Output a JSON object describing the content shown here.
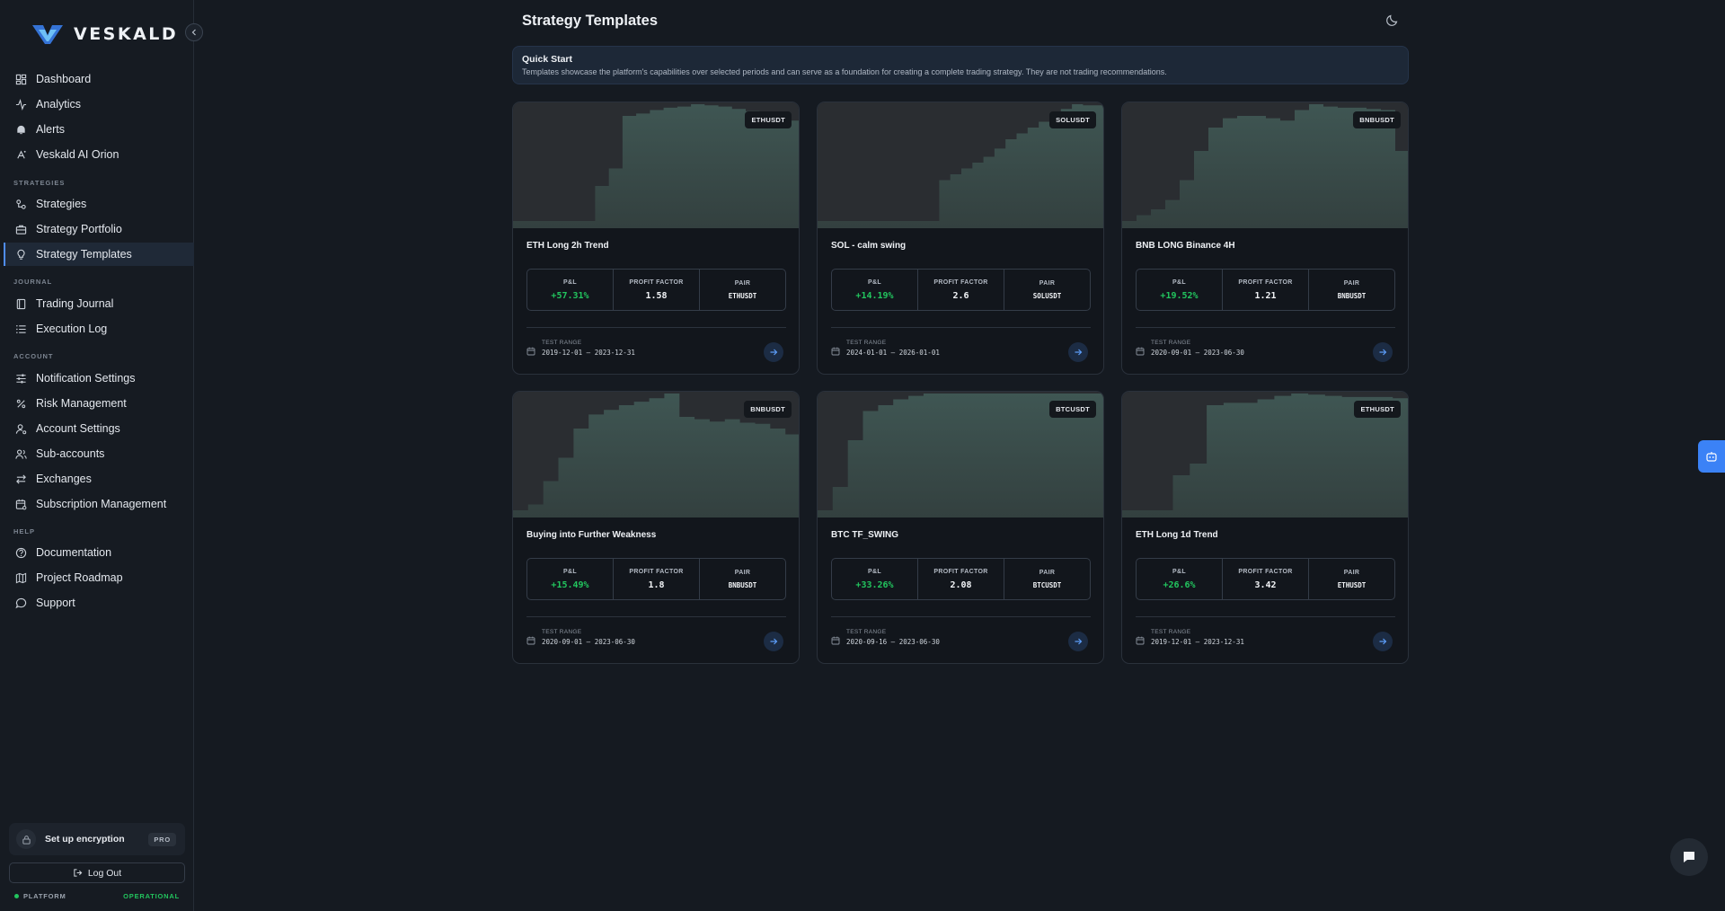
{
  "app": {
    "name": "VESKALD"
  },
  "sidebar": {
    "main_items": [
      {
        "label": "Dashboard",
        "icon": "dashboard-icon"
      },
      {
        "label": "Analytics",
        "icon": "analytics-icon"
      },
      {
        "label": "Alerts",
        "icon": "bell-icon"
      },
      {
        "label": "Veskald AI Orion",
        "icon": "ai-icon"
      }
    ],
    "sections": [
      {
        "title": "STRATEGIES",
        "items": [
          {
            "label": "Strategies",
            "icon": "strategies-icon"
          },
          {
            "label": "Strategy Portfolio",
            "icon": "briefcase-icon"
          },
          {
            "label": "Strategy Templates",
            "icon": "lightbulb-icon",
            "active": true
          }
        ]
      },
      {
        "title": "JOURNAL",
        "items": [
          {
            "label": "Trading Journal",
            "icon": "book-icon"
          },
          {
            "label": "Execution Log",
            "icon": "list-icon"
          }
        ]
      },
      {
        "title": "ACCOUNT",
        "items": [
          {
            "label": "Notification Settings",
            "icon": "sliders-icon"
          },
          {
            "label": "Risk Management",
            "icon": "percent-icon"
          },
          {
            "label": "Account Settings",
            "icon": "user-gear-icon"
          },
          {
            "label": "Sub-accounts",
            "icon": "users-icon"
          },
          {
            "label": "Exchanges",
            "icon": "swap-icon"
          },
          {
            "label": "Subscription Management",
            "icon": "calendar-settings-icon"
          }
        ]
      },
      {
        "title": "HELP",
        "items": [
          {
            "label": "Documentation",
            "icon": "help-circle-icon"
          },
          {
            "label": "Project Roadmap",
            "icon": "map-icon"
          },
          {
            "label": "Support",
            "icon": "chat-bubble-icon"
          }
        ]
      }
    ],
    "encryption": {
      "label": "Set up encryption",
      "badge": "PRO"
    },
    "logout_label": "Log Out",
    "platform": {
      "label": "PLATFORM",
      "status": "OPERATIONAL"
    }
  },
  "header": {
    "title": "Strategy Templates"
  },
  "quick_start": {
    "title": "Quick Start",
    "text": "Templates showcase the platform's capabilities over selected periods and can serve as a foundation for creating a complete trading strategy. They are not trading recommendations."
  },
  "labels": {
    "pnl": "P&L",
    "profit_factor": "PROFIT FACTOR",
    "pair": "PAIR",
    "test_range": "TEST RANGE"
  },
  "cards": [
    {
      "title": "ETH Long 2h Trend",
      "pair": "ETHUSDT",
      "pnl": "+57.31%",
      "profit_factor": "1.58",
      "range": "2019-12-01 — 2023-12-31"
    },
    {
      "title": "SOL - calm swing",
      "pair": "SOLUSDT",
      "pnl": "+14.19%",
      "profit_factor": "2.6",
      "range": "2024-01-01 — 2026-01-01"
    },
    {
      "title": "BNB LONG Binance 4H",
      "pair": "BNBUSDT",
      "pnl": "+19.52%",
      "profit_factor": "1.21",
      "range": "2020-09-01 — 2023-06-30"
    },
    {
      "title": "Buying into Further Weakness",
      "pair": "BNBUSDT",
      "pnl": "+15.49%",
      "profit_factor": "1.8",
      "range": "2020-09-01 — 2023-06-30"
    },
    {
      "title": "BTC TF_SWING",
      "pair": "BTCUSDT",
      "pnl": "+33.26%",
      "profit_factor": "2.08",
      "range": "2020-09-16 — 2023-06-30"
    },
    {
      "title": "ETH Long 1d Trend",
      "pair": "ETHUSDT",
      "pnl": "+26.6%",
      "profit_factor": "3.42",
      "range": "2019-12-01 — 2023-12-31"
    }
  ],
  "equity_curves": [
    [
      0.0,
      0.0,
      0.0,
      0.0,
      0.0,
      0.0,
      0.3,
      0.45,
      0.9,
      0.92,
      0.95,
      0.97,
      0.98,
      1.0,
      0.99,
      0.98,
      0.96,
      0.94,
      0.91,
      0.88,
      0.86
    ],
    [
      0.0,
      0.0,
      0.0,
      0.0,
      0.0,
      0.0,
      0.0,
      0.0,
      0.0,
      0.0,
      0.0,
      0.35,
      0.4,
      0.45,
      0.5,
      0.55,
      0.62,
      0.7,
      0.75,
      0.8,
      0.85,
      0.9,
      0.96,
      1.0,
      0.99,
      0.99
    ],
    [
      0.0,
      0.05,
      0.1,
      0.18,
      0.35,
      0.6,
      0.8,
      0.88,
      0.9,
      0.9,
      0.88,
      0.86,
      0.95,
      1.0,
      0.98,
      0.97,
      0.97,
      0.96,
      0.95,
      0.6
    ],
    [
      0.0,
      0.05,
      0.25,
      0.45,
      0.7,
      0.82,
      0.86,
      0.9,
      0.93,
      0.96,
      1.0,
      0.8,
      0.78,
      0.76,
      0.78,
      0.75,
      0.74,
      0.7,
      0.65
    ],
    [
      0.0,
      0.2,
      0.6,
      0.85,
      0.9,
      0.95,
      0.98,
      1.0,
      1.0,
      1.0,
      1.0,
      1.0,
      1.0,
      1.0,
      1.0,
      1.0,
      1.0,
      1.0,
      1.0
    ],
    [
      0.0,
      0.0,
      0.0,
      0.3,
      0.4,
      0.9,
      0.92,
      0.92,
      0.95,
      0.98,
      1.0,
      0.99,
      0.98,
      0.97,
      0.97,
      0.97,
      0.96
    ]
  ],
  "colors": {
    "accent": "#4f8df5",
    "positive": "#22c55e",
    "chart_fill": "#3a4b4d",
    "chart_bg": "#2a2d31"
  }
}
